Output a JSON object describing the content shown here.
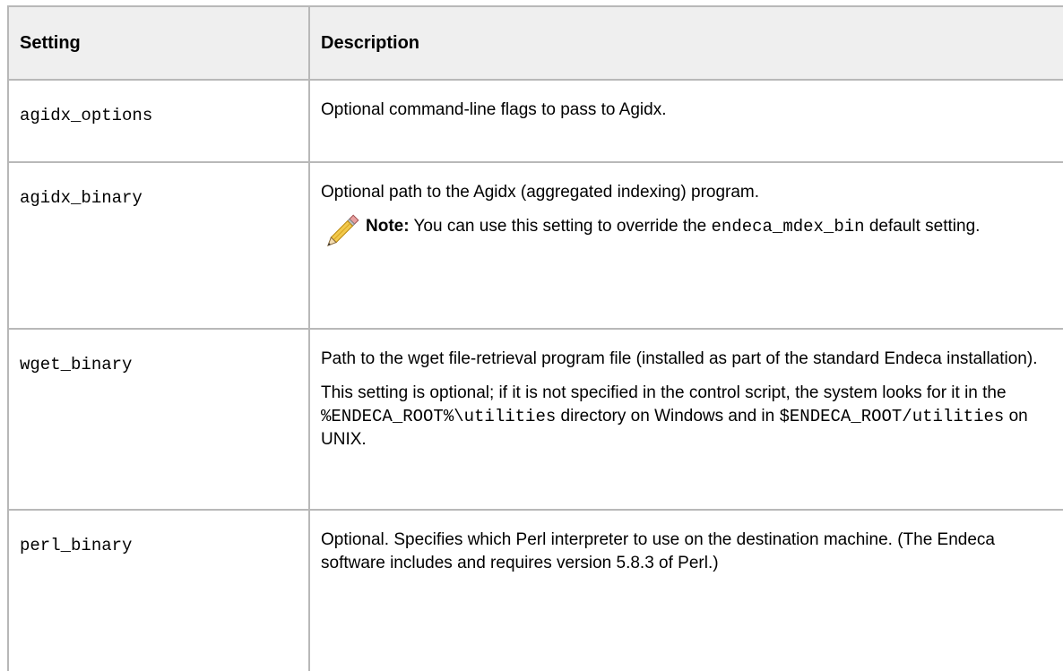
{
  "table": {
    "headers": {
      "setting": "Setting",
      "description": "Description"
    },
    "rows": [
      {
        "setting": "agidx_options",
        "desc_p1": "Optional command-line flags to pass to Agidx."
      },
      {
        "setting": "agidx_binary",
        "desc_p1": "Optional path to the Agidx (aggregated indexing) program.",
        "note_label": "Note:",
        "note_text_1": " You can use this setting to override the ",
        "note_code": "endeca_mdex_bin",
        "note_text_2": " default setting."
      },
      {
        "setting": "wget_binary",
        "desc_p1": "Path to the wget file-retrieval program file (installed as part of the standard Endeca installation).",
        "desc_p2_a": "This setting is optional; if it is not specified in the control script, the system looks for it in the ",
        "desc_p2_code1": "%ENDECA_ROOT%\\utilities",
        "desc_p2_b": " directory on Windows and in ",
        "desc_p2_code2": "$ENDECA_ROOT/utilities",
        "desc_p2_c": " on UNIX."
      },
      {
        "setting": "perl_binary",
        "desc_p1": "Optional. Specifies which Perl interpreter to use on the destination machine. (The Endeca software includes and requires version 5.8.3 of Perl.)"
      }
    ]
  },
  "icons": {
    "note": "pencil-icon"
  },
  "colors": {
    "header_bg": "#efefef",
    "border": "#b8b8b8"
  }
}
